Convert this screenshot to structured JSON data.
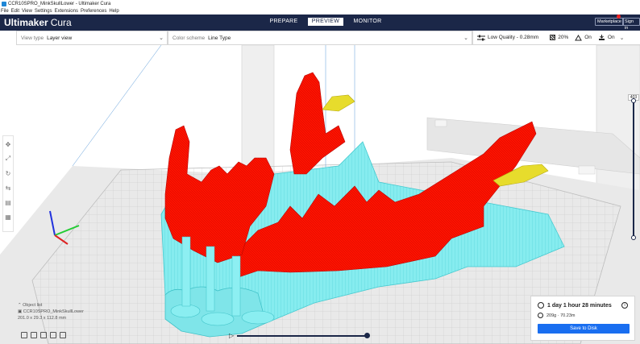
{
  "window": {
    "title": "CCR10SPRO_MinkSkullLower - Ultimaker Cura"
  },
  "menu": [
    "File",
    "Edit",
    "View",
    "Settings",
    "Extensions",
    "Preferences",
    "Help"
  ],
  "header": {
    "brand_bold": "Ultimaker",
    "brand_light": "Cura",
    "stages": [
      "PREPARE",
      "PREVIEW",
      "MONITOR"
    ],
    "active_stage": "PREVIEW",
    "marketplace_label": "Marketplace",
    "signin_label": "Sign in"
  },
  "toolbar": {
    "view_type_label": "View type",
    "view_type_value": "Layer view",
    "color_scheme_label": "Color scheme",
    "color_scheme_value": "Line Type",
    "quality": "Low Quality - 0.28mm",
    "infill": "20%",
    "support": "On",
    "adhesion": "On"
  },
  "layer_view": {
    "current_layer": "403",
    "top_position": 1.0,
    "bottom_position": 0.0
  },
  "objects": {
    "title": "Object list",
    "name": "CCR10SPRO_MinkSkullLower",
    "dimensions": "201.0 x 29.3 x 112.8 mm"
  },
  "print": {
    "time": "1 day 1 hour 28 minutes",
    "material": "209g · 70.23m",
    "save_label": "Save to Disk"
  },
  "colors": {
    "header_bg": "#1b2748",
    "model_red": "#ff0d00",
    "support_cyan": "#7ce6ea",
    "infill_yellow": "#e0d428",
    "save_button": "#196ef0"
  },
  "icons": {
    "time": "clock-icon",
    "material": "material-meter-icon",
    "info": "info-icon",
    "quality": "quality-sliders-icon",
    "infill": "infill-icon",
    "support": "support-icon",
    "adhesion": "adhesion-icon"
  }
}
